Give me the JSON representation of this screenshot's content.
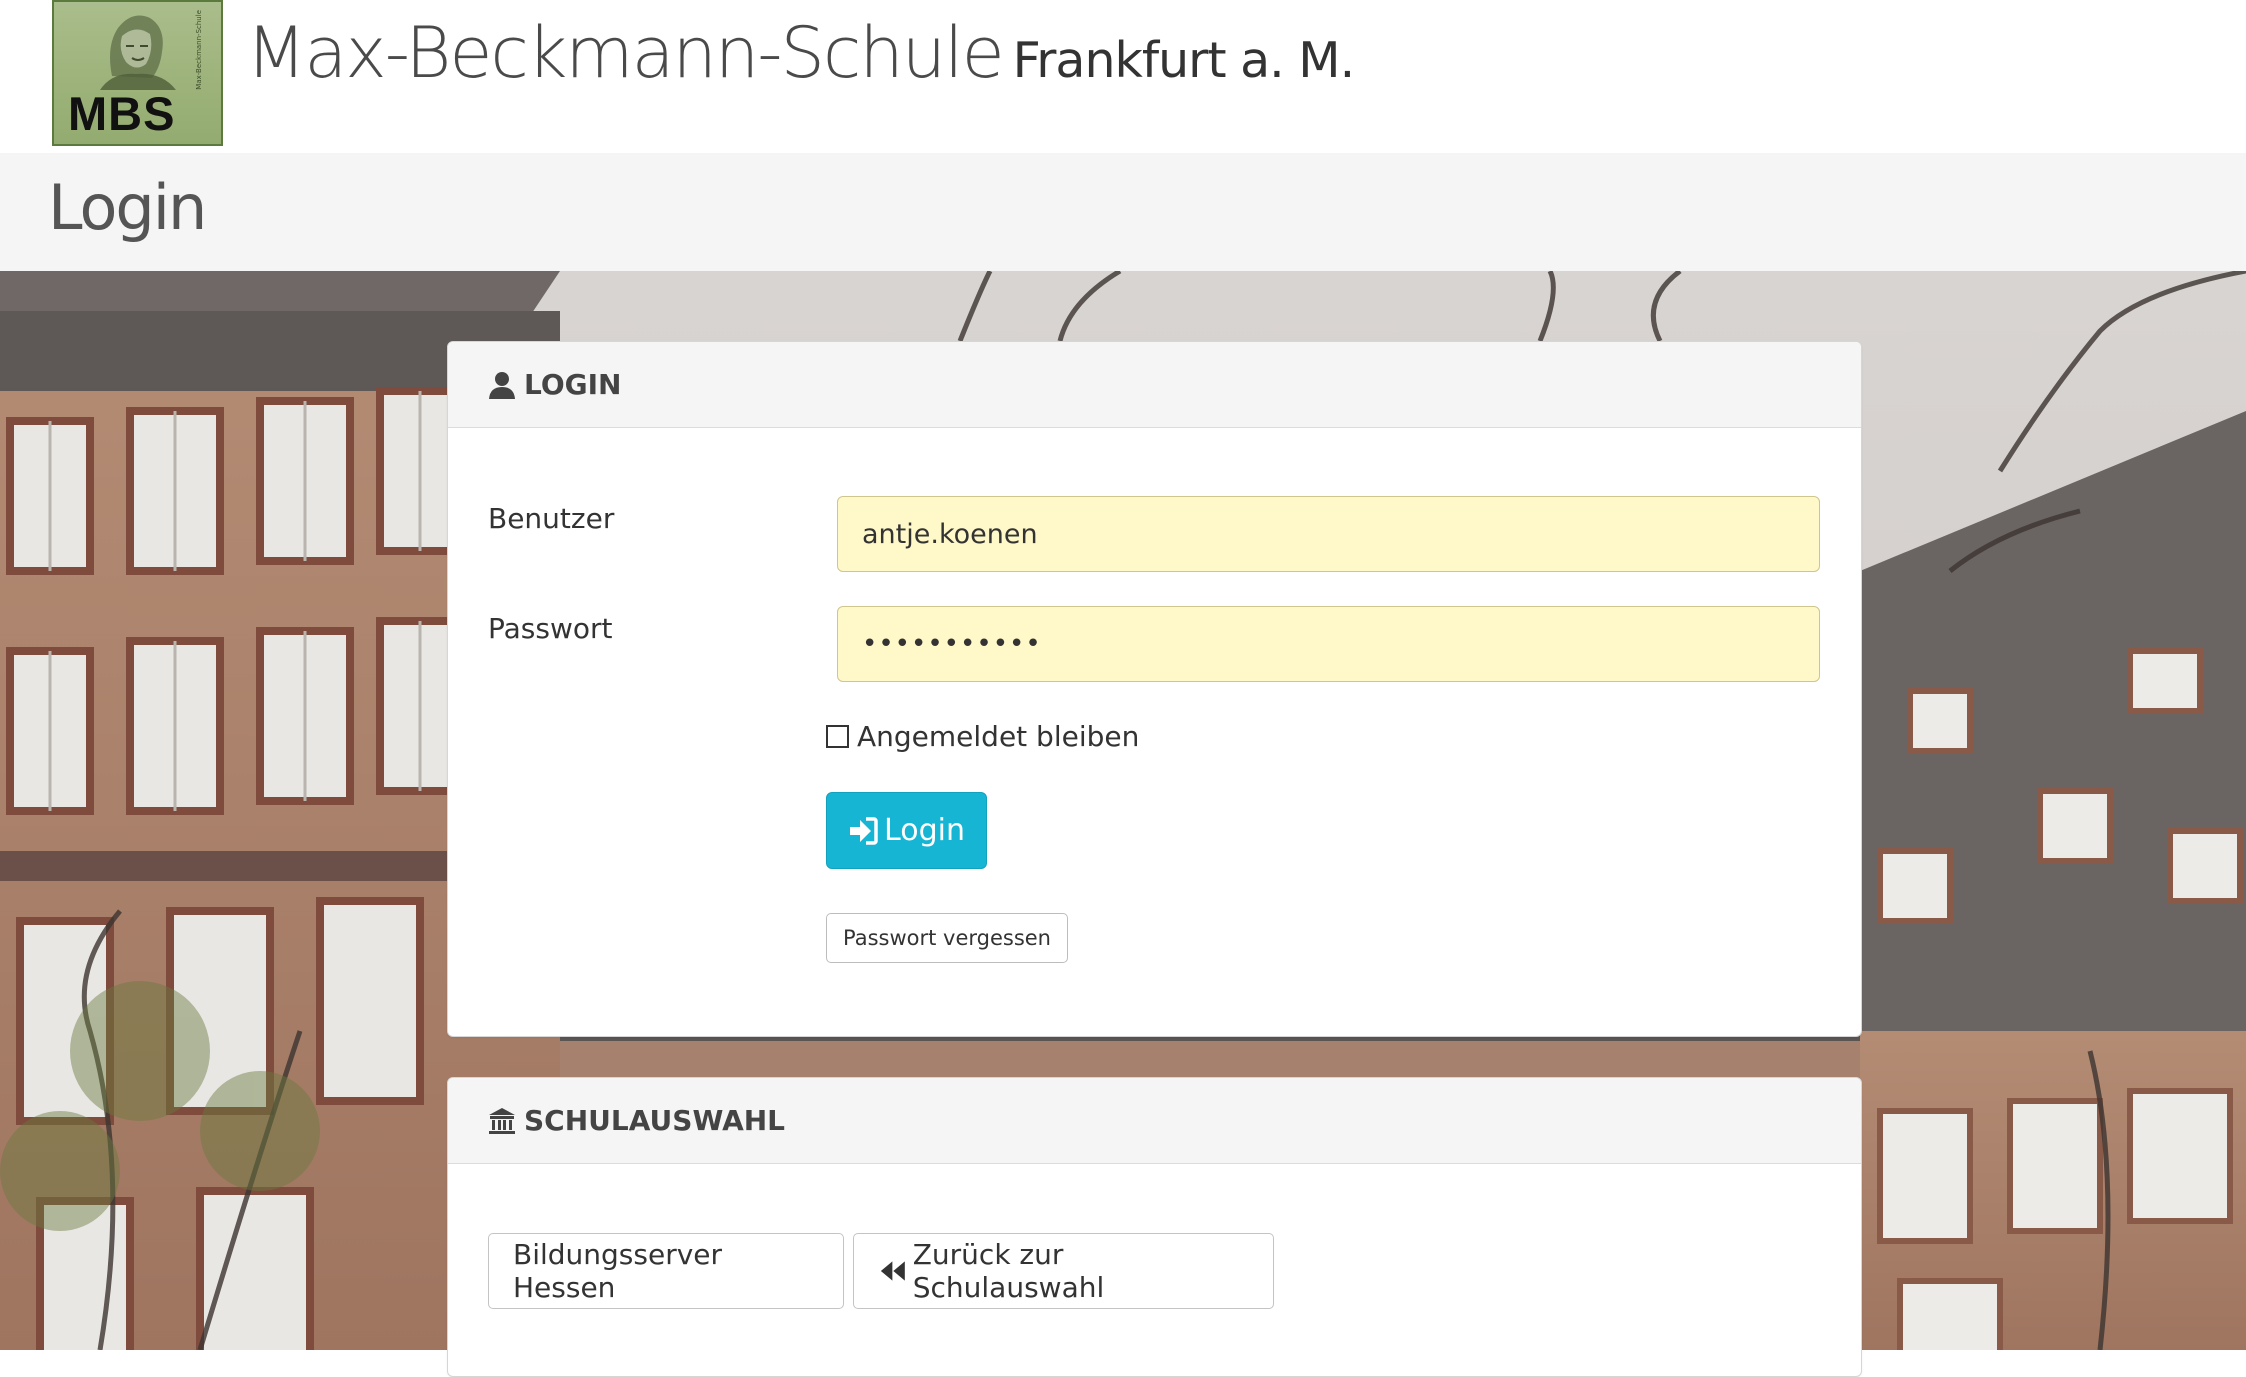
{
  "header": {
    "logo_text": "MBS",
    "logo_side_text": "Max-Beckmann-Schule",
    "title_main": "Max-Beckmann-Schule",
    "title_sub": "Frankfurt a. M."
  },
  "page": {
    "heading": "Login"
  },
  "login_panel": {
    "heading": "LOGIN",
    "heading_icon": "user-icon",
    "user_label": "Benutzer",
    "user_value": "antje.koenen",
    "password_label": "Passwort",
    "password_value": "•••••••••••",
    "remember_label": "Angemeldet bleiben",
    "remember_checked": false,
    "login_button": "Login",
    "login_icon": "sign-in-icon",
    "forgot_button": "Passwort vergessen"
  },
  "school_panel": {
    "heading": "SCHULAUSWAHL",
    "heading_icon": "institution-icon",
    "server_button": "Bildungsserver Hessen",
    "back_button": "Zurück zur Schulauswahl",
    "back_icon": "fast-backward-icon"
  },
  "colors": {
    "primary_button": "#17b5d4",
    "input_autofill": "#fff8c9",
    "logo_green": "#9db37b"
  }
}
